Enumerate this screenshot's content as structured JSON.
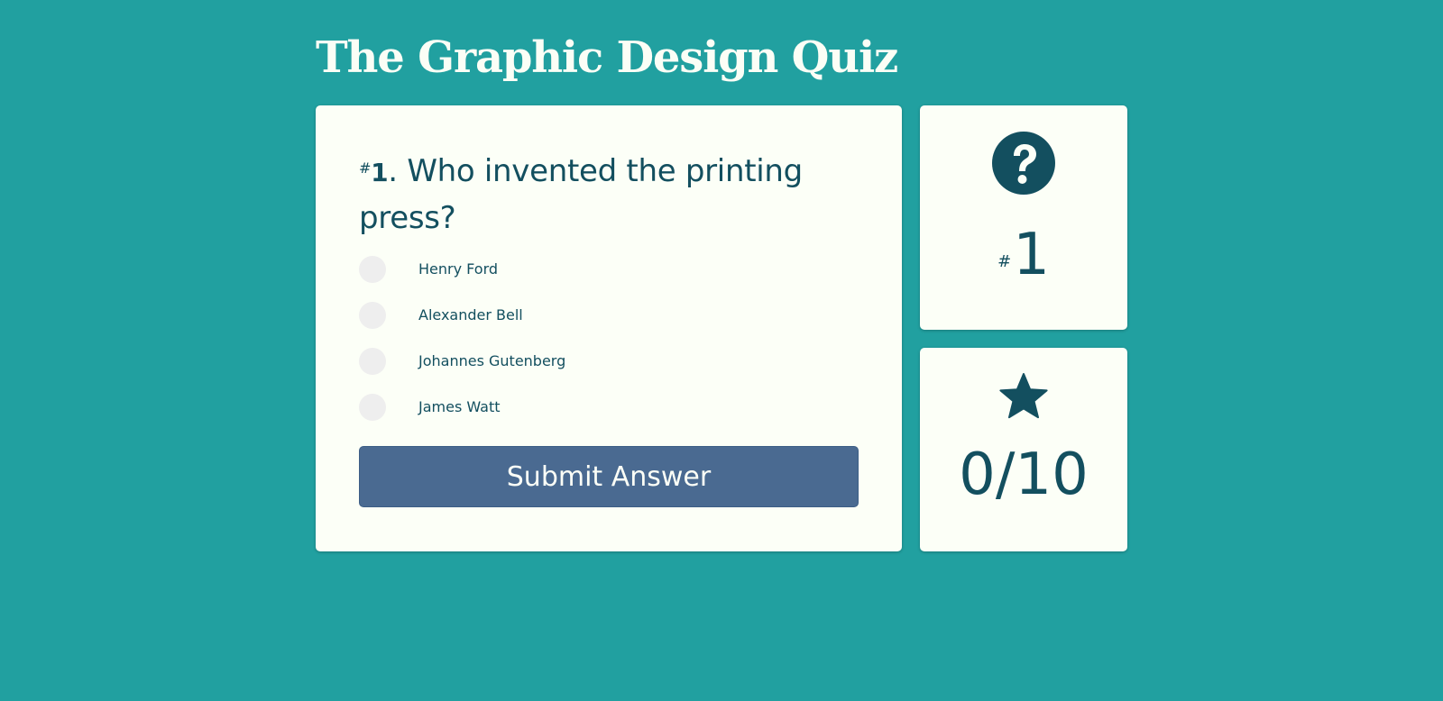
{
  "header": {
    "title": "The Graphic Design Quiz"
  },
  "question": {
    "hash": "#",
    "number": "1",
    "separator": ".",
    "text": "Who invented the printing press?",
    "options": [
      {
        "label": "Henry Ford"
      },
      {
        "label": "Alexander Bell"
      },
      {
        "label": "Johannes Gutenberg"
      },
      {
        "label": "James Watt"
      }
    ],
    "submit_label": "Submit Answer"
  },
  "progress": {
    "icon": "question-circle-icon",
    "hash": "#",
    "current_number": "1"
  },
  "score": {
    "icon": "star-icon",
    "value": "0/10"
  },
  "colors": {
    "background": "#21a0a0",
    "card": "#fcfff7",
    "text": "#134f5f",
    "button": "#4a6a91",
    "radio": "#eeeeee"
  }
}
